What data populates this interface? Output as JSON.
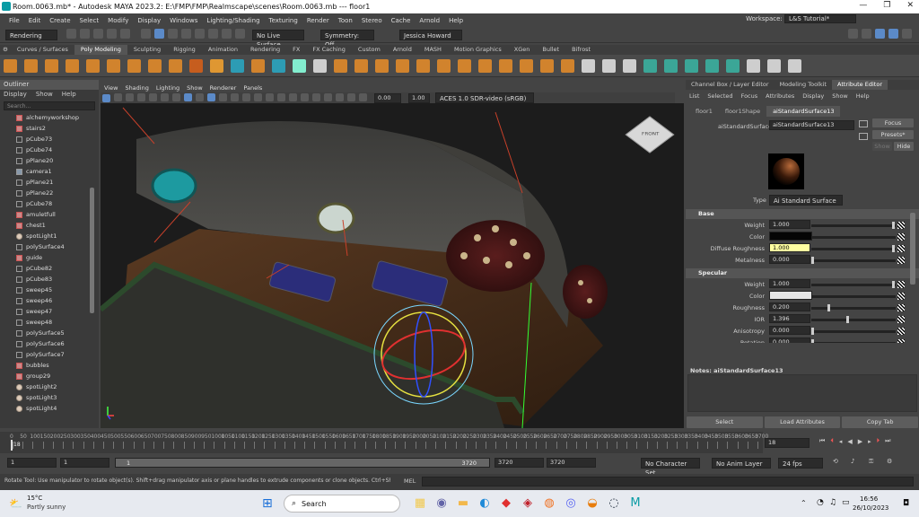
{
  "window": {
    "title": "Room.0063.mb* - Autodesk MAYA 2023.2: E:\\FMP\\FMP\\Realmscape\\scenes\\Room.0063.mb  ---  floor1"
  },
  "menus": [
    "File",
    "Edit",
    "Create",
    "Select",
    "Modify",
    "Display",
    "Windows",
    "Lighting/Shading",
    "Texturing",
    "Render",
    "Toon",
    "Stereo",
    "Cache",
    "Arnold",
    "Help"
  ],
  "workspace": {
    "label": "Workspace:",
    "value": "L&S Tutorial*"
  },
  "toolbar": {
    "menuset": "Rendering",
    "live_surface": "No Live Surface",
    "symmetry": "Symmetry: Off",
    "user": "Jessica Howard"
  },
  "shelf_tabs": [
    "Curves / Surfaces",
    "Poly Modeling",
    "Sculpting",
    "Rigging",
    "Animation",
    "Rendering",
    "FX",
    "FX Caching",
    "Custom",
    "Arnold",
    "MASH",
    "Motion Graphics",
    "XGen",
    "Bullet",
    "Bifrost"
  ],
  "shelf_active_index": 1,
  "outliner": {
    "title": "Outliner",
    "menu": [
      "Display",
      "Show",
      "Help"
    ],
    "search_placeholder": "Search...",
    "items": [
      {
        "label": "alchemyworkshop",
        "kind": "grp"
      },
      {
        "label": "stairs2",
        "kind": "grp"
      },
      {
        "label": "pCube73",
        "kind": "mesh"
      },
      {
        "label": "pCube74",
        "kind": "mesh"
      },
      {
        "label": "pPlane20",
        "kind": "mesh"
      },
      {
        "label": "camera1",
        "kind": "cam"
      },
      {
        "label": "pPlane21",
        "kind": "mesh"
      },
      {
        "label": "pPlane22",
        "kind": "mesh"
      },
      {
        "label": "pCube78",
        "kind": "mesh"
      },
      {
        "label": "amuletfull",
        "kind": "grp"
      },
      {
        "label": "chest1",
        "kind": "grp"
      },
      {
        "label": "spotLight1",
        "kind": "lgt"
      },
      {
        "label": "polySurface4",
        "kind": "mesh"
      },
      {
        "label": "guide",
        "kind": "grp"
      },
      {
        "label": "pCube82",
        "kind": "mesh"
      },
      {
        "label": "pCube83",
        "kind": "mesh"
      },
      {
        "label": "sweep45",
        "kind": "mesh"
      },
      {
        "label": "sweep46",
        "kind": "mesh"
      },
      {
        "label": "sweep47",
        "kind": "mesh"
      },
      {
        "label": "sweep48",
        "kind": "mesh"
      },
      {
        "label": "polySurface5",
        "kind": "mesh"
      },
      {
        "label": "polySurface6",
        "kind": "mesh"
      },
      {
        "label": "polySurface7",
        "kind": "mesh"
      },
      {
        "label": "bubbles",
        "kind": "grp"
      },
      {
        "label": "group29",
        "kind": "grp"
      },
      {
        "label": "spotLight2",
        "kind": "lgt"
      },
      {
        "label": "spotLight3",
        "kind": "lgt"
      },
      {
        "label": "spotLight4",
        "kind": "lgt"
      }
    ]
  },
  "viewport": {
    "menu": [
      "View",
      "Shading",
      "Lighting",
      "Show",
      "Renderer",
      "Panels"
    ],
    "exposure": "0.00",
    "gamma": "1.00",
    "colorspace": "ACES 1.0 SDR-video (sRGB)",
    "cube_label": "FRONT"
  },
  "right_tabs": [
    "Channel Box / Layer Editor",
    "Modeling Toolkit",
    "Attribute Editor"
  ],
  "right_tab_active": 2,
  "attr_editor": {
    "menu": [
      "List",
      "Selected",
      "Focus",
      "Attributes",
      "Display",
      "Show",
      "Help"
    ],
    "node_tabs": [
      "floor1",
      "floor1Shape",
      "aiStandardSurface13"
    ],
    "node_tab_active": 2,
    "node_label": "aiStandardSurface:",
    "node_value": "aiStandardSurface13",
    "focus": "Focus",
    "presets": "Presets*",
    "show": "Show",
    "hide": "Hide",
    "type_label": "Type",
    "type_value": "Ai Standard Surface",
    "base_section": "Base",
    "base": [
      {
        "label": "Weight",
        "value": "1.000",
        "slider": 1.0,
        "swatch": ""
      },
      {
        "label": "Color",
        "value": "",
        "slider": null,
        "swatch": "#050505"
      },
      {
        "label": "Diffuse Roughness",
        "value": "1.000",
        "slider": 1.0,
        "swatch": "",
        "highlight": true
      },
      {
        "label": "Metalness",
        "value": "0.000",
        "slider": 0.0,
        "swatch": ""
      }
    ],
    "spec_section": "Specular",
    "specular": [
      {
        "label": "Weight",
        "value": "1.000",
        "slider": 1.0,
        "swatch": ""
      },
      {
        "label": "Color",
        "value": "",
        "slider": null,
        "swatch": "#e6e6e6"
      },
      {
        "label": "Roughness",
        "value": "0.200",
        "slider": 0.2,
        "swatch": ""
      },
      {
        "label": "IOR",
        "value": "1.396",
        "slider": 0.43,
        "swatch": ""
      },
      {
        "label": "Anisotropy",
        "value": "0.000",
        "slider": 0.0,
        "swatch": ""
      },
      {
        "label": "Rotation",
        "value": "0.000",
        "slider": 0.0,
        "swatch": ""
      }
    ],
    "notes_label": "Notes:",
    "notes_node": "aiStandardSurface13",
    "buttons": [
      "Select",
      "Load Attributes",
      "Copy Tab"
    ]
  },
  "timeline": {
    "ticks": [
      "0",
      "50",
      "100",
      "150",
      "200",
      "250",
      "300",
      "350",
      "400",
      "450",
      "500",
      "550",
      "600",
      "650",
      "700",
      "750",
      "800",
      "850",
      "900",
      "950",
      "1000",
      "1050",
      "1100",
      "1150",
      "1200",
      "1250",
      "1300",
      "1350",
      "1400",
      "1450",
      "1500",
      "1550",
      "1600",
      "1650",
      "1700",
      "1750",
      "1800",
      "1850",
      "1900",
      "1950",
      "2000",
      "2050",
      "2100",
      "2150",
      "2200",
      "2250",
      "2300",
      "2350",
      "2400",
      "2450",
      "2500",
      "2550",
      "2600",
      "2650",
      "2700",
      "2750",
      "2800",
      "2850",
      "2900",
      "2950",
      "3000",
      "3050",
      "3100",
      "3150",
      "3200",
      "3250",
      "3300",
      "3350",
      "3400",
      "3450",
      "3500",
      "3550",
      "3600",
      "3650",
      "3700"
    ],
    "current_frame": "18",
    "frame_field": "18"
  },
  "range": {
    "start": "1",
    "start2": "1",
    "range_start": "1",
    "range_end": "3720",
    "end": "3720",
    "end2": "3720",
    "character": "No Character Set",
    "anim_layer": "No Anim Layer",
    "fps": "24 fps"
  },
  "help": {
    "text": "Rotate Tool: Use manipulator to rotate object(s). Shift+drag manipulator axis or plane handles to extrude components or clone objects. Ctrl+Shift+LMB+d",
    "mel": "MEL"
  },
  "taskbar": {
    "temp": "15°C",
    "weather": "Partly sunny",
    "search": "Search",
    "time": "16:56",
    "date": "26/10/2023"
  }
}
